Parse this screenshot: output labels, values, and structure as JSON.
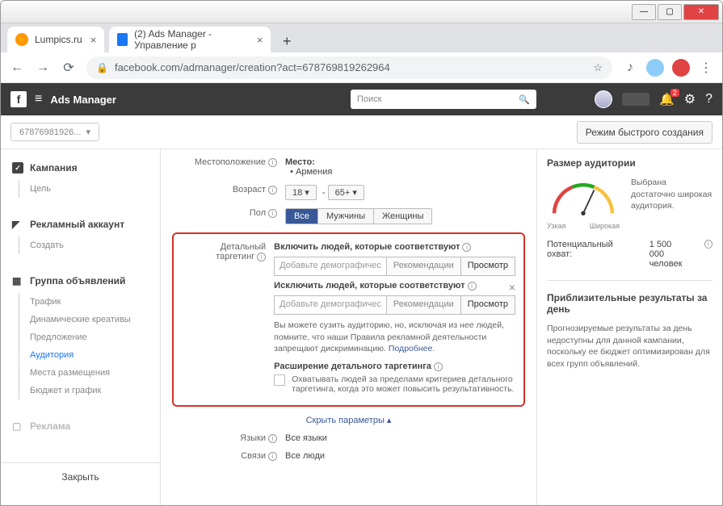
{
  "browser": {
    "tabs": [
      {
        "title": "Lumpics.ru"
      },
      {
        "title": "(2) Ads Manager - Управление р"
      }
    ],
    "url": "facebook.com/admanager/creation?act=678769819262964"
  },
  "header": {
    "app": "Ads Manager",
    "search_placeholder": "Поиск",
    "bell_count": "2"
  },
  "topbar": {
    "account": "67876981926...",
    "fast_button": "Режим быстрого создания"
  },
  "sidebar": {
    "sec1": {
      "title": "Кампания",
      "items": [
        "Цель"
      ]
    },
    "sec2": {
      "title": "Рекламный аккаунт",
      "items": [
        "Создать"
      ]
    },
    "sec3": {
      "title": "Группа объявлений",
      "items": [
        "Трафик",
        "Динамические креативы",
        "Предложение",
        "Аудитория",
        "Места размещения",
        "Бюджет и график"
      ]
    },
    "sec4": {
      "title": "Реклама"
    },
    "close": "Закрыть"
  },
  "form": {
    "location_label": "Местоположение",
    "location_head": "Место:",
    "location_val": "Армения",
    "age_label": "Возраст",
    "age_min": "18",
    "age_max": "65+",
    "gender_label": "Пол",
    "gender_opts": [
      "Все",
      "Мужчины",
      "Женщины"
    ],
    "targeting_label": "Детальный таргетинг",
    "include_label": "Включить людей, которые соответствуют",
    "exclude_label": "Исключить людей, которые соответствуют",
    "placeholder": "Добавьте демографичес",
    "rec_btn": "Рекомендации",
    "view_btn": "Просмотр",
    "note": "Вы можете сузить аудиторию, но, исключая из нее людей, помните, что наши Правила рекламной деятельности запрещают дискриминацию.",
    "note_link": "Подробнее.",
    "expand_title": "Расширение детального таргетинга",
    "expand_text": "Охватывать людей за пределами критериев детального таргетинга, когда это может повысить результативность.",
    "hide": "Скрыть параметры ▴",
    "lang_label": "Языки",
    "lang_val": "Все языки",
    "conn_label": "Связи",
    "conn_val": "Все люди"
  },
  "right": {
    "size_title": "Размер аудитории",
    "gauge_narrow": "Узкая",
    "gauge_wide": "Широкая",
    "size_desc": "Выбрана достаточно широкая аудитория.",
    "reach_label": "Потенциальный охват:",
    "reach_val": "1 500 000",
    "reach_unit": "человек",
    "approx_title": "Приблизительные результаты за день",
    "approx_text": "Прогнозируемые результаты за день недоступны для данной кампании, поскольку ее бюджет оптимизирован для всех групп объявлений."
  }
}
